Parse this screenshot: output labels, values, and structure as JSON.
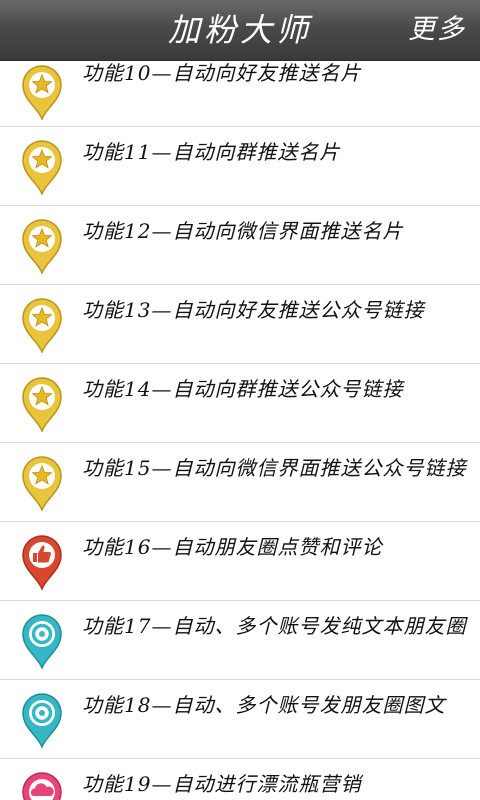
{
  "header": {
    "title": "加粉大师",
    "more": "更多"
  },
  "colors": {
    "gold": "#e9c43c",
    "red": "#d9472e",
    "teal": "#35b7c4",
    "pink": "#e8437a"
  },
  "items": [
    {
      "label": "功能10—自动向好友推送名片",
      "icon": "star-pin-icon"
    },
    {
      "label": "功能11—自动向群推送名片",
      "icon": "star-pin-icon"
    },
    {
      "label": "功能12—自动向微信界面推送名片",
      "icon": "star-pin-icon"
    },
    {
      "label": "功能13—自动向好友推送公众号链接",
      "icon": "star-pin-icon"
    },
    {
      "label": "功能14—自动向群推送公众号链接",
      "icon": "star-pin-icon"
    },
    {
      "label": "功能15—自动向微信界面推送公众号链接",
      "icon": "star-pin-icon"
    },
    {
      "label": "功能16—自动朋友圈点赞和评论",
      "icon": "thumbs-up-pin-icon"
    },
    {
      "label": "功能17—自动、多个账号发纯文本朋友圈",
      "icon": "camera-pin-icon"
    },
    {
      "label": "功能18—自动、多个账号发朋友圈图文",
      "icon": "camera-pin-icon"
    },
    {
      "label": "功能19—自动进行漂流瓶营销",
      "icon": "cloud-pin-icon"
    }
  ]
}
